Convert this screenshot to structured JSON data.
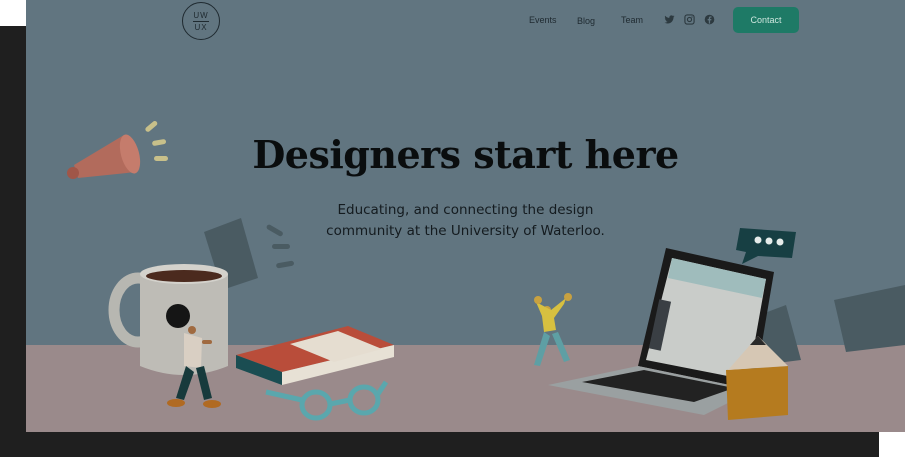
{
  "logo": {
    "line1": "UW",
    "line2": "UX"
  },
  "nav": {
    "events": "Events",
    "blog": "Blog",
    "team": "Team",
    "contact": "Contact"
  },
  "social": [
    "twitter-icon",
    "instagram-icon",
    "facebook-icon"
  ],
  "hero": {
    "title": "Designers start here",
    "subtitle_line1": "Educating, and connecting the design",
    "subtitle_line2": "community at the University of Waterloo."
  },
  "colors": {
    "background": "#617580",
    "floor": "#9a8a8b",
    "accent": "#1e7a66"
  }
}
